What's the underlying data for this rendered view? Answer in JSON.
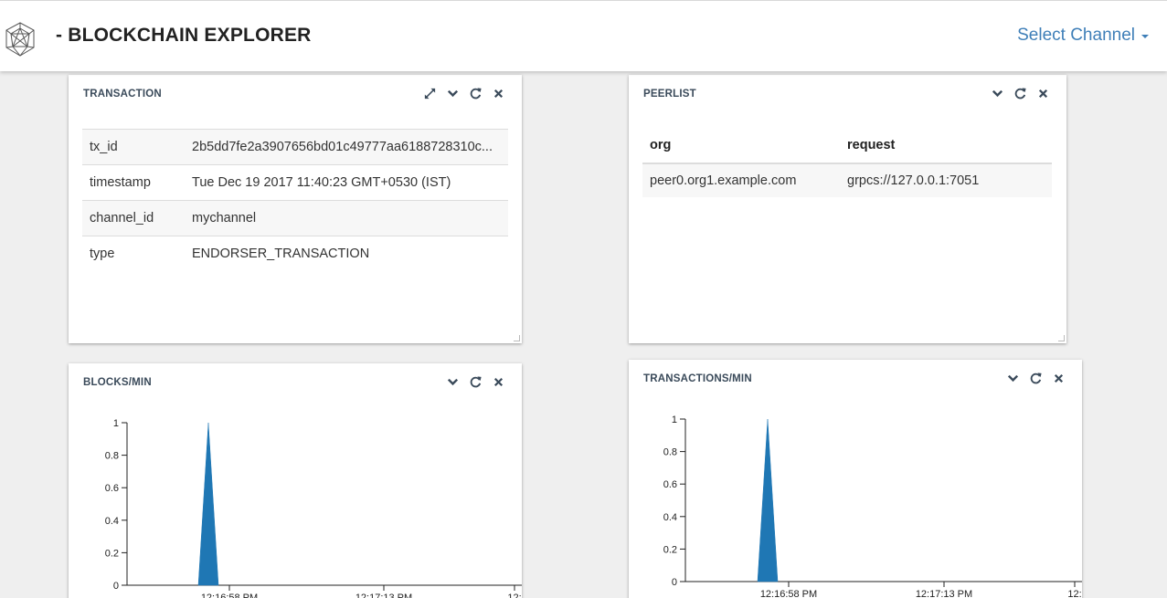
{
  "header": {
    "title": "- BLOCKCHAIN EXPLORER",
    "channel_select_label": "Select Channel"
  },
  "transaction_panel": {
    "title": "TRANSACTION",
    "tools": [
      "expand-icon",
      "chevron-down-icon",
      "refresh-icon",
      "close-icon"
    ],
    "rows": [
      {
        "key": "tx_id",
        "value": "2b5dd7fe2a3907656bd01c49777aa6188728310c..."
      },
      {
        "key": "timestamp",
        "value": "Tue Dec 19 2017 11:40:23 GMT+0530 (IST)"
      },
      {
        "key": "channel_id",
        "value": "mychannel"
      },
      {
        "key": "type",
        "value": "ENDORSER_TRANSACTION"
      }
    ]
  },
  "peerlist_panel": {
    "title": "PEERLIST",
    "tools": [
      "chevron-down-icon",
      "refresh-icon",
      "close-icon"
    ],
    "columns": [
      "org",
      "request"
    ],
    "rows": [
      {
        "org": "peer0.org1.example.com",
        "request": "grpcs://127.0.0.1:7051"
      }
    ]
  },
  "blocks_panel": {
    "title": "BLOCKS/MIN",
    "tools": [
      "chevron-down-icon",
      "refresh-icon",
      "close-icon"
    ]
  },
  "transactions_panel": {
    "title": "TRANSACTIONS/MIN",
    "tools": [
      "chevron-down-icon",
      "refresh-icon",
      "close-icon"
    ]
  },
  "colors": {
    "accent": "#3f7fb8",
    "series": "#1f77b4"
  },
  "chart_data": [
    {
      "type": "area",
      "title": "BLOCKS/MIN",
      "y_ticks": [
        "0",
        "0.2",
        "0.4",
        "0.6",
        "0.8",
        "1"
      ],
      "x_ticks": [
        "12:16:58 PM",
        "12:17:13 PM",
        "12:"
      ],
      "ylim": [
        0,
        1
      ],
      "points": [
        {
          "t": "12:16:55 PM",
          "y": 0
        },
        {
          "t": "12:16:56 PM",
          "y": 1
        },
        {
          "t": "12:16:57 PM",
          "y": 0
        }
      ],
      "grid": false
    },
    {
      "type": "area",
      "title": "TRANSACTIONS/MIN",
      "y_ticks": [
        "0",
        "0.2",
        "0.4",
        "0.6",
        "0.8",
        "1"
      ],
      "x_ticks": [
        "12:16:58 PM",
        "12:17:13 PM",
        "12:"
      ],
      "ylim": [
        0,
        1
      ],
      "points": [
        {
          "t": "12:16:55 PM",
          "y": 0
        },
        {
          "t": "12:16:56 PM",
          "y": 1
        },
        {
          "t": "12:16:57 PM",
          "y": 0
        }
      ],
      "grid": false
    }
  ]
}
